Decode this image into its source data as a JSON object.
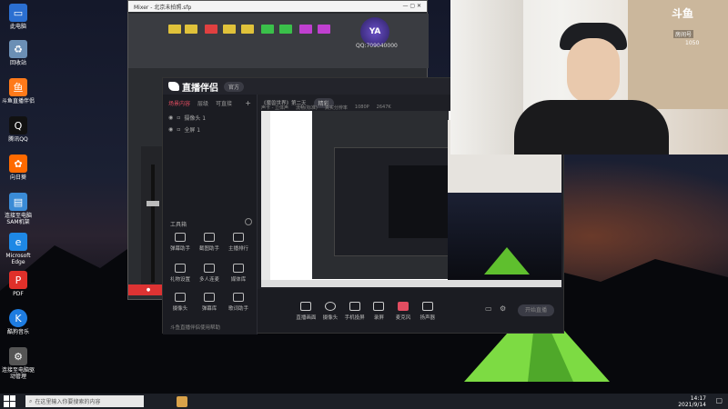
{
  "desktop": {
    "icons": [
      {
        "label": "此电脑",
        "icon": "computer-icon",
        "color": "#2b6fd1"
      },
      {
        "label": "回收站",
        "icon": "recycle-bin-icon",
        "color": "#6b8fb5"
      },
      {
        "label": "斗鱼直播伴侣",
        "icon": "douyu-icon",
        "color": "#ff7a1a"
      },
      {
        "label": "腾讯QQ",
        "icon": "qq-icon",
        "color": "#111111"
      },
      {
        "label": "向日葵",
        "icon": "sunflower-icon",
        "color": "#ff6a00"
      },
      {
        "label": "连接至电脑SAM机架",
        "icon": "sam-rack-icon",
        "color": "#3a8bd6"
      },
      {
        "label": "Microsoft Edge",
        "icon": "edge-icon",
        "color": "#1e88e5"
      },
      {
        "label": "PDF",
        "icon": "pdf-icon",
        "color": "#e0302a"
      },
      {
        "label": "酷狗音乐",
        "icon": "kugou-icon",
        "color": "#1e7ce0"
      },
      {
        "label": "连接至电脑驱动管理",
        "icon": "driver-icon",
        "color": "#555555"
      }
    ]
  },
  "taskbar": {
    "search_placeholder": "在这里输入你要搜索的内容",
    "time": "14:17",
    "date": "2021/9/14"
  },
  "mixer": {
    "title": "Mixer - 北京未拍照.sfp",
    "qq_label": "QQ:709040000",
    "brand": "YA"
  },
  "broadcast": {
    "brand": "直播伴侣",
    "version_badge": "官方",
    "left_tabs": [
      "场景内容",
      "层级",
      "可直接"
    ],
    "sources": [
      "摄像头 1",
      "全屏 1"
    ],
    "toolbox_label": "工具箱",
    "tools": [
      "弹幕助手",
      "截图助手",
      "主播排行",
      "礼物设置",
      "多人连麦",
      "媒体库",
      "摄像头",
      "弹幕库",
      "歌词助手"
    ],
    "preview_title": "《魔兽世界》第二天",
    "preview_tag": "精彩",
    "stats": [
      "声卡 - 立体声",
      "流畅(标准)",
      "真实分辨率",
      "1080P",
      "2647K"
    ],
    "bottom_buttons": [
      "直播画面",
      "摄像头",
      "手机投屏",
      "录屏",
      "麦克风",
      "扬声器"
    ],
    "start_live": "开始直播",
    "footer_note": "斗鱼直播伴侣使用帮助"
  },
  "webcam": {
    "watermark": "斗鱼",
    "room_label": "房间号",
    "room_number": "1050"
  },
  "colors": {
    "accent": "#e24d61",
    "grass": "#6cc83c",
    "panel": "#1e1f25"
  }
}
